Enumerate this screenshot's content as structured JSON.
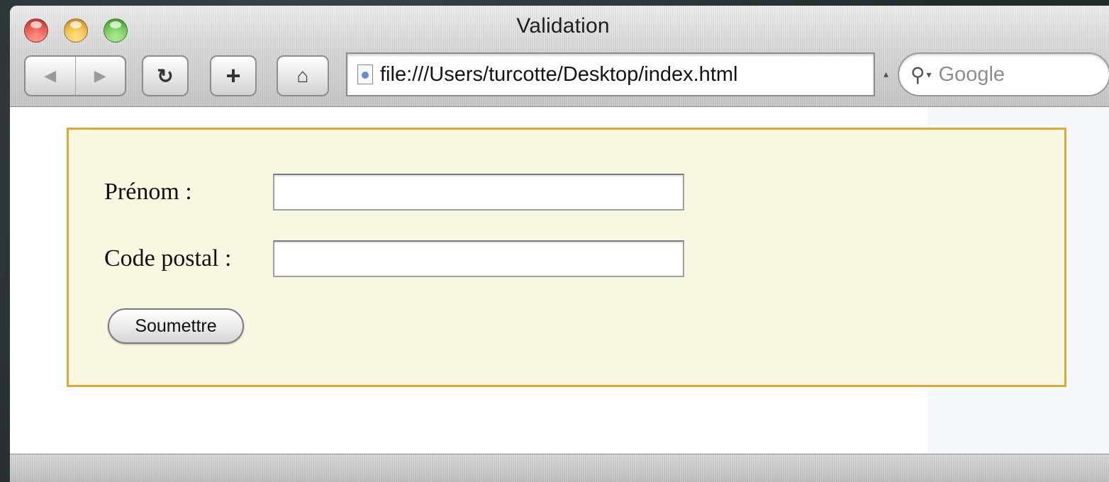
{
  "window": {
    "title": "Validation"
  },
  "toolbar": {
    "back_icon": "◀",
    "forward_icon": "▶",
    "reload_icon": "↻",
    "add_icon": "+",
    "home_icon": "⌂",
    "address": "file:///Users/turcotte/Desktop/index.html",
    "snapback_icon": "▴",
    "search_icon": "⚲",
    "search_menu_icon": "▾",
    "search_placeholder": "Google"
  },
  "form": {
    "prenom_label": "Prénom :",
    "prenom_value": "",
    "code_postal_label": "Code postal :",
    "code_postal_value": "",
    "submit_label": "Soumettre"
  },
  "colors": {
    "form_background": "#f8f7e1",
    "form_border": "#d9a93a",
    "close": "#d4281a",
    "minimize": "#e79a12",
    "maximize": "#3aa620"
  }
}
